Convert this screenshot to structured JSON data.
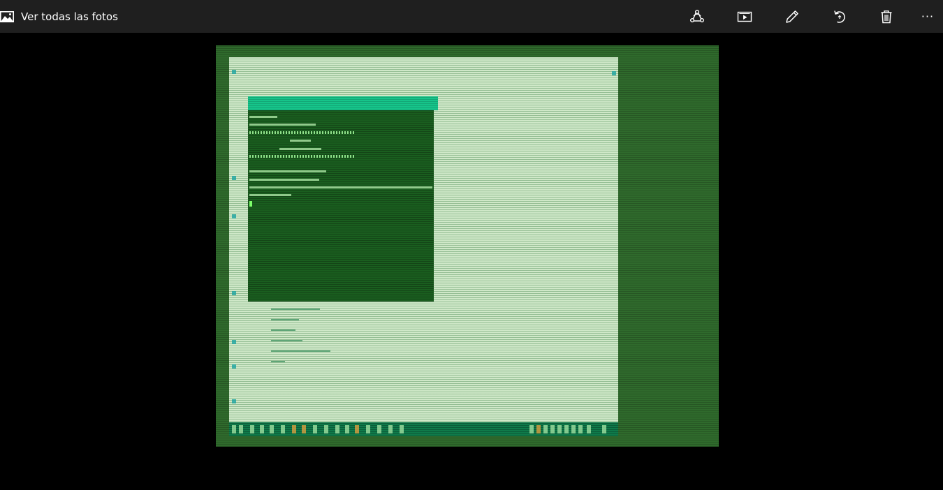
{
  "toolbar": {
    "title": "Ver todas las fotos",
    "icons": {
      "app": "photos-icon",
      "share": "share-icon",
      "slideshow": "slideshow-icon",
      "edit": "pencil-icon",
      "rotate": "rotate-icon",
      "delete": "trash-icon",
      "more": "more-icon"
    },
    "more_label": "···"
  },
  "colors": {
    "toolbar_bg": "#1f1f1f",
    "viewer_bg": "#000000",
    "photo_frame": "#2f6a2c",
    "photo_screen": "#cfe8c8",
    "terminal_bg": "#1a5e1f",
    "terminal_titlebar": "#16c48a",
    "taskbar": "#0f7a4a"
  }
}
